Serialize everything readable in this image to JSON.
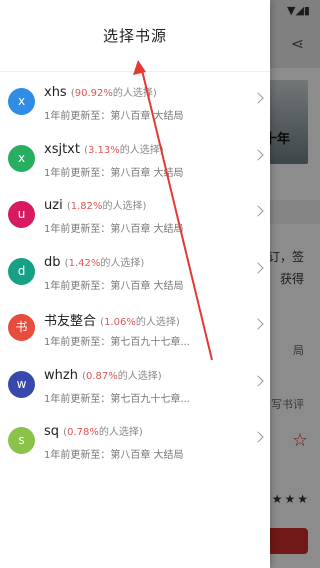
{
  "drawer": {
    "title": "选择书源"
  },
  "sources": [
    {
      "avatar": "x",
      "color": "#2f8de4",
      "name": "xhs",
      "pct": "90.92%",
      "suffix": "的人选择)",
      "prefix": "(",
      "update": "1年前更新至：第八百章 大结局"
    },
    {
      "avatar": "x",
      "color": "#27ae60",
      "name": "xsjtxt",
      "pct": "3.13%",
      "suffix": "的人选择)",
      "prefix": "(",
      "update": "1年前更新至：第八百章 大结局"
    },
    {
      "avatar": "u",
      "color": "#d81b60",
      "name": "uzi",
      "pct": "1.82%",
      "suffix": "的人选择)",
      "prefix": "(",
      "update": "1年前更新至：第八百章 大结局"
    },
    {
      "avatar": "d",
      "color": "#16a085",
      "name": "db",
      "pct": "1.42%",
      "suffix": "的人选择)",
      "prefix": "(",
      "update": "1年前更新至：第八百章 大结局"
    },
    {
      "avatar": "书",
      "color": "#e74c3c",
      "name": "书友整合",
      "pct": "1.06%",
      "suffix": "的人选择)",
      "prefix": "(",
      "update": "1年前更新至：第七百九十七章..."
    },
    {
      "avatar": "w",
      "color": "#3949ab",
      "name": "whzh",
      "pct": "0.87%",
      "suffix": "的人选择)",
      "prefix": "(",
      "update": "1年前更新至：第七百九十七章..."
    },
    {
      "avatar": "s",
      "color": "#8bc34a",
      "name": "sq",
      "pct": "0.78%",
      "suffix": "的人选择)",
      "prefix": "(",
      "update": "1年前更新至：第八百章 大结局"
    }
  ],
  "background": {
    "cover_text": "十年",
    "line_a": "订，签",
    "line_b": "获得",
    "line_c": "局",
    "line_d": "写书评",
    "star": "☆",
    "stars": "★★★"
  },
  "annotation_color": "#e53935"
}
